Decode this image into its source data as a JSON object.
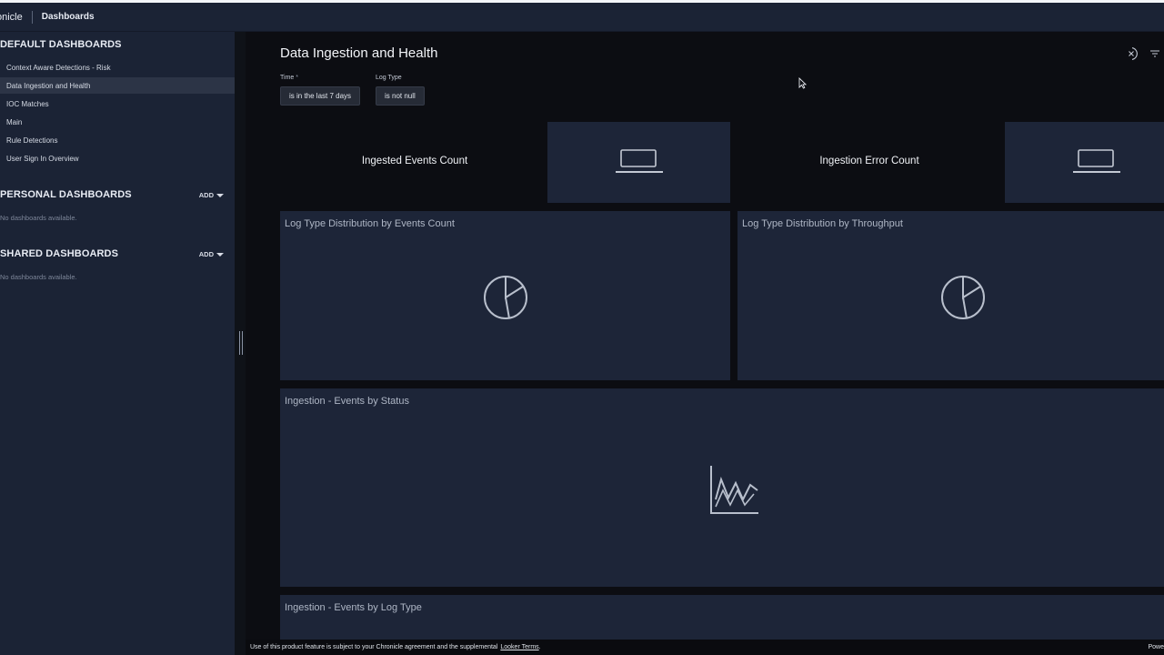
{
  "topbar": {
    "brand": "onicle",
    "breadcrumb": "Dashboards"
  },
  "sidebar": {
    "default": {
      "title": "DEFAULT DASHBOARDS",
      "items": [
        {
          "label": "Context Aware Detections - Risk"
        },
        {
          "label": "Data Ingestion and Health"
        },
        {
          "label": "IOC Matches"
        },
        {
          "label": "Main"
        },
        {
          "label": "Rule Detections"
        },
        {
          "label": "User Sign In Overview"
        }
      ]
    },
    "personal": {
      "title": "PERSONAL DASHBOARDS",
      "add": "ADD",
      "empty": "No dashboards available."
    },
    "shared": {
      "title": "SHARED DASHBOARDS",
      "add": "ADD",
      "empty": "No dashboards available."
    }
  },
  "main": {
    "title": "Data Ingestion and Health",
    "filters": [
      {
        "label": "Time",
        "required_mark": "*",
        "value": "is in the last 7 days"
      },
      {
        "label": "Log Type",
        "value": "is not null"
      }
    ],
    "tiles": {
      "ingested_events": "Ingested Events Count",
      "ingestion_errors": "Ingestion Error Count",
      "log_type_events": "Log Type Distribution by Events Count",
      "log_type_throughput": "Log Type Distribution by Throughput",
      "events_by_status": "Ingestion - Events by Status",
      "events_by_log_type": "Ingestion - Events by Log Type"
    },
    "icons": {
      "single_value": "laptop-icon",
      "pie": "pie-chart-icon",
      "line": "line-chart-icon"
    }
  },
  "footer": {
    "text": "Use of this product feature is subject to your Chronicle agreement and the supplemental",
    "link": "Looker Terms",
    "link_suffix": ".",
    "right": "Powe"
  },
  "colors": {
    "sidebar_bg": "#1b2335",
    "tile_bg": "#1d2538",
    "main_bg": "#0c0d12",
    "active_item_bg": "#2c3446"
  }
}
